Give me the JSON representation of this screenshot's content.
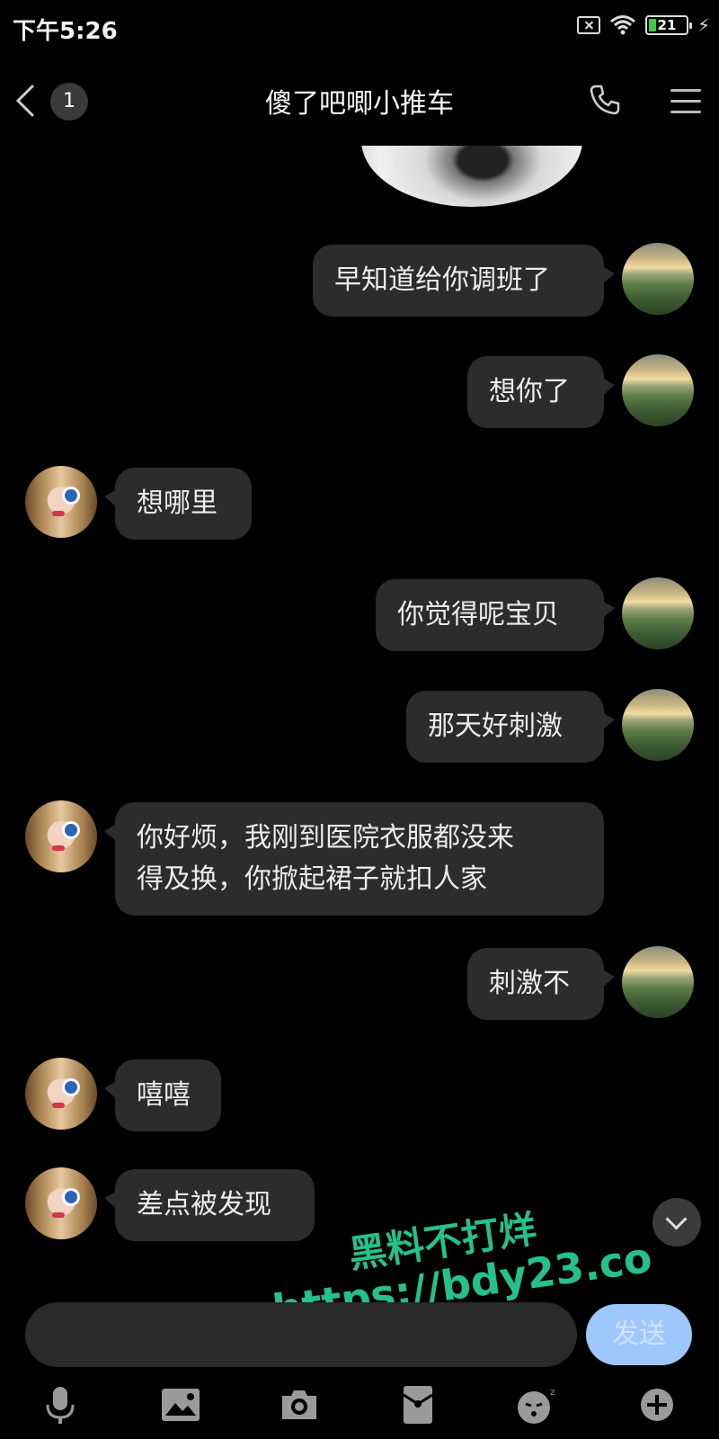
{
  "status_bar": {
    "time": "下午5:26",
    "battery": "21",
    "icons": [
      "sim-off-icon",
      "wifi-icon",
      "battery-icon",
      "charging-bolt-icon"
    ]
  },
  "header": {
    "back_icon": "chevron-left-icon",
    "unread_count": "1",
    "title": "傻了吧唧小推车",
    "call_icon": "phone-icon",
    "menu_icon": "hamburger-menu-icon"
  },
  "messages": [
    {
      "side": "right",
      "text": "早知道给你调班了"
    },
    {
      "side": "right",
      "text": "想你了"
    },
    {
      "side": "left",
      "text": "想哪里"
    },
    {
      "side": "right",
      "text": "你觉得呢宝贝"
    },
    {
      "side": "right",
      "text": "那天好刺激"
    },
    {
      "side": "left",
      "text": "你好烦，我刚到医院衣服都没来\n得及换，你掀起裙子就扣人家"
    },
    {
      "side": "right",
      "text": "刺激不"
    },
    {
      "side": "left",
      "text": "嘻嘻"
    },
    {
      "side": "left",
      "text": "差点被发现"
    }
  ],
  "watermark": {
    "line1": "黑料不打烊",
    "line2": "https://bdy23.co"
  },
  "composer": {
    "input_value": "",
    "send_label": "发送"
  },
  "toolbar": {
    "items": [
      "microphone-icon",
      "image-icon",
      "camera-icon",
      "red-packet-icon",
      "emoji-icon",
      "plus-icon"
    ]
  },
  "colors": {
    "background": "#000000",
    "bubble": "#2c2c2c",
    "send_button": "#9ec7fb",
    "watermark": "#26c08d"
  }
}
